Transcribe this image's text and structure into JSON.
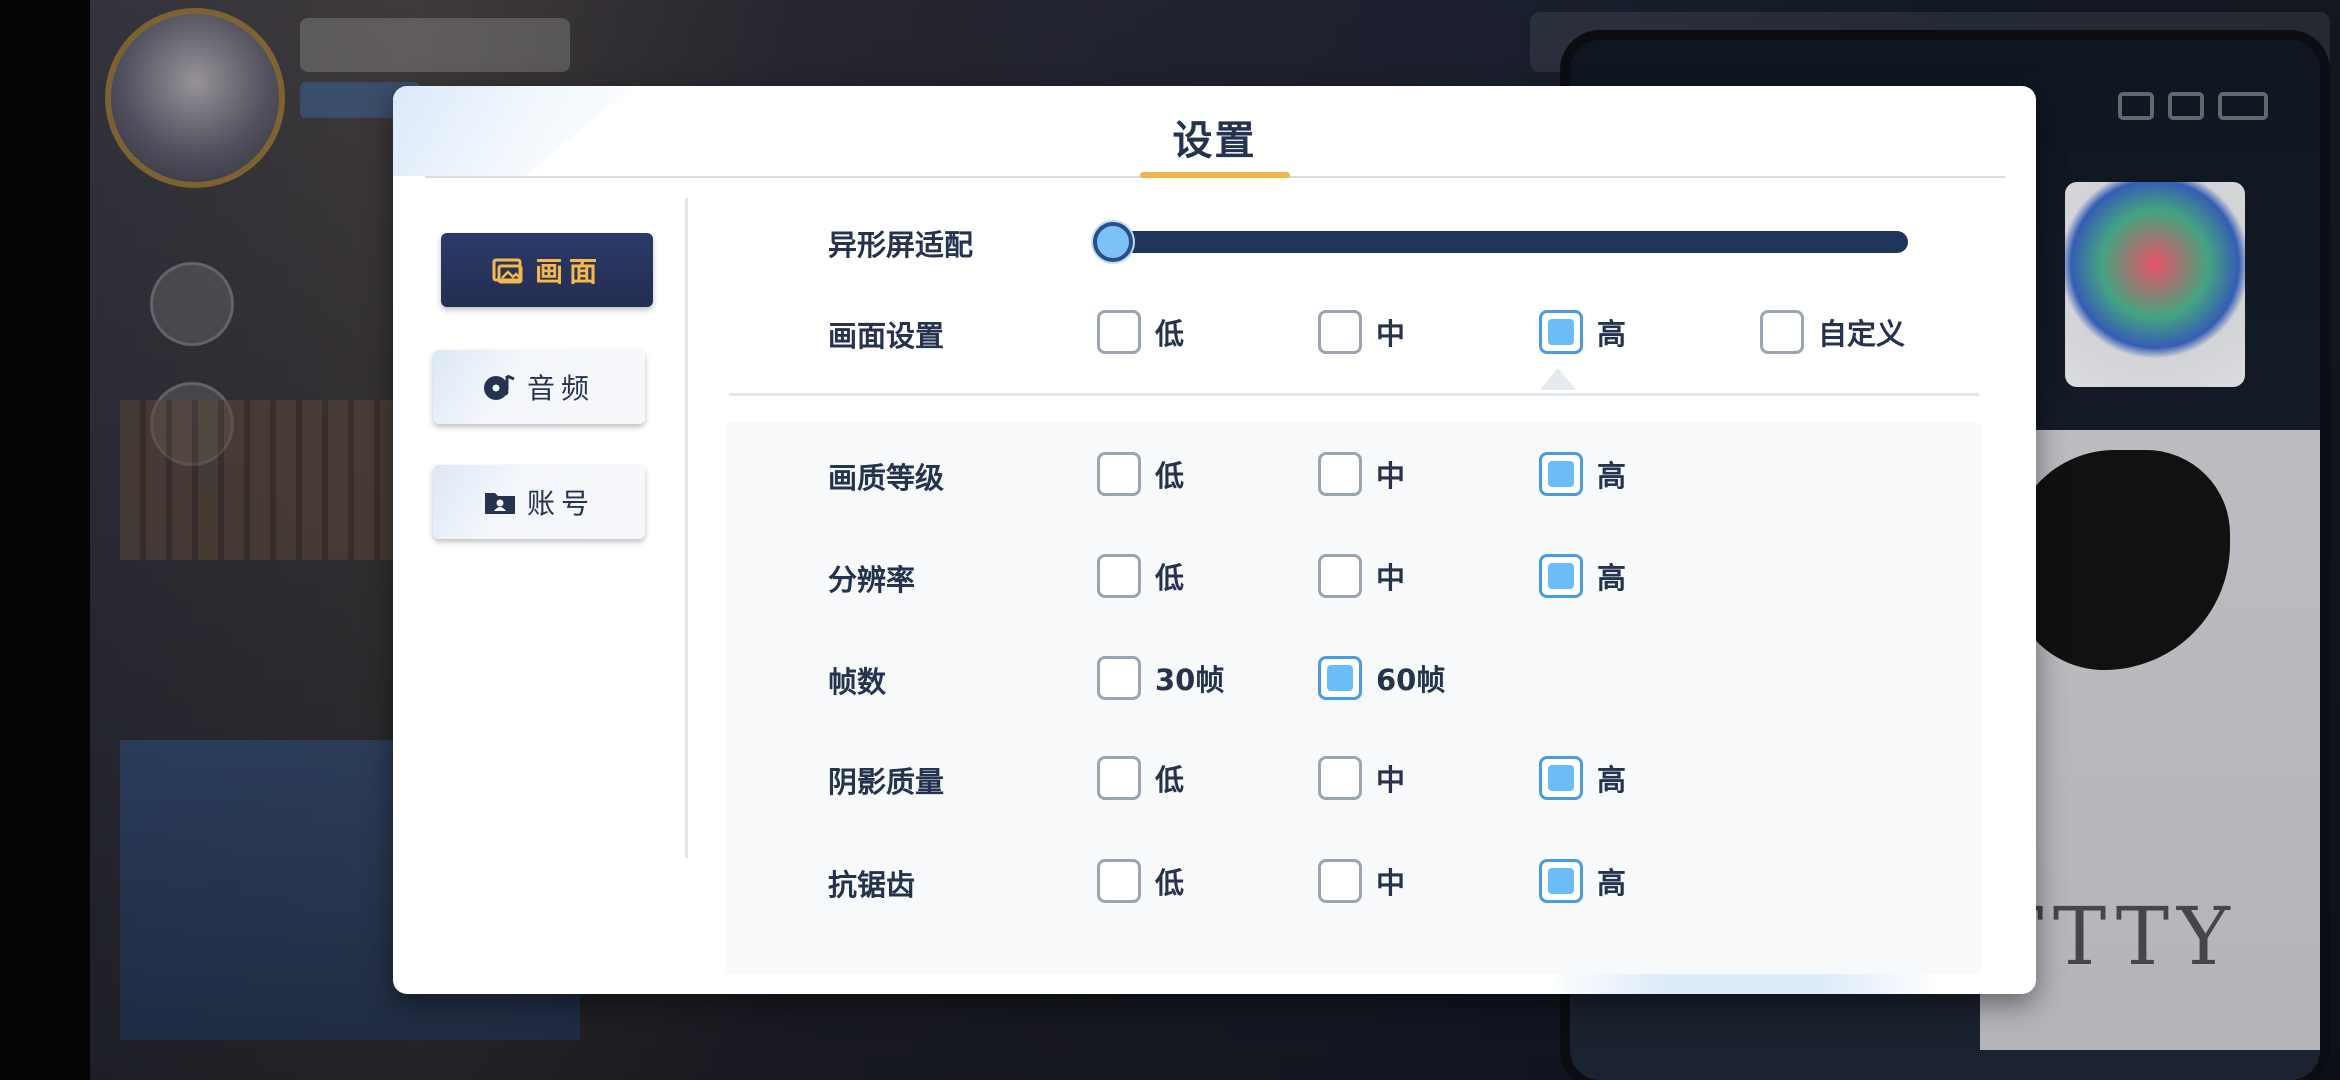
{
  "dialog": {
    "title": "设置"
  },
  "tabs": [
    {
      "label": "画面",
      "icon": "picture-folder-icon",
      "active": true
    },
    {
      "label": "音频",
      "icon": "music-disc-icon",
      "active": false
    },
    {
      "label": "账号",
      "icon": "account-folder-icon",
      "active": false
    }
  ],
  "notch_adapt": {
    "label": "异形屏适配",
    "value": 0.0
  },
  "display_setting": {
    "label": "画面设置",
    "options": [
      "低",
      "中",
      "高",
      "自定义"
    ],
    "selected": "高"
  },
  "quality": {
    "label": "画质等级",
    "options": [
      "低",
      "中",
      "高"
    ],
    "selected": "高"
  },
  "resolution": {
    "label": "分辨率",
    "options": [
      "低",
      "中",
      "高"
    ],
    "selected": "高"
  },
  "fps": {
    "label": "帧数",
    "options": [
      "30帧",
      "60帧"
    ],
    "selected": "60帧"
  },
  "shadow": {
    "label": "阴影质量",
    "options": [
      "低",
      "中",
      "高"
    ],
    "selected": "高"
  },
  "antialias": {
    "label": "抗锯齿",
    "options": [
      "低",
      "中",
      "高"
    ],
    "selected": "高"
  },
  "colors": {
    "accent": "#f0b548",
    "tab_active_bg": "#26325c",
    "checkbox_checked": "#6bbcf7",
    "slider_track": "#1f355c",
    "text": "#25334f"
  }
}
